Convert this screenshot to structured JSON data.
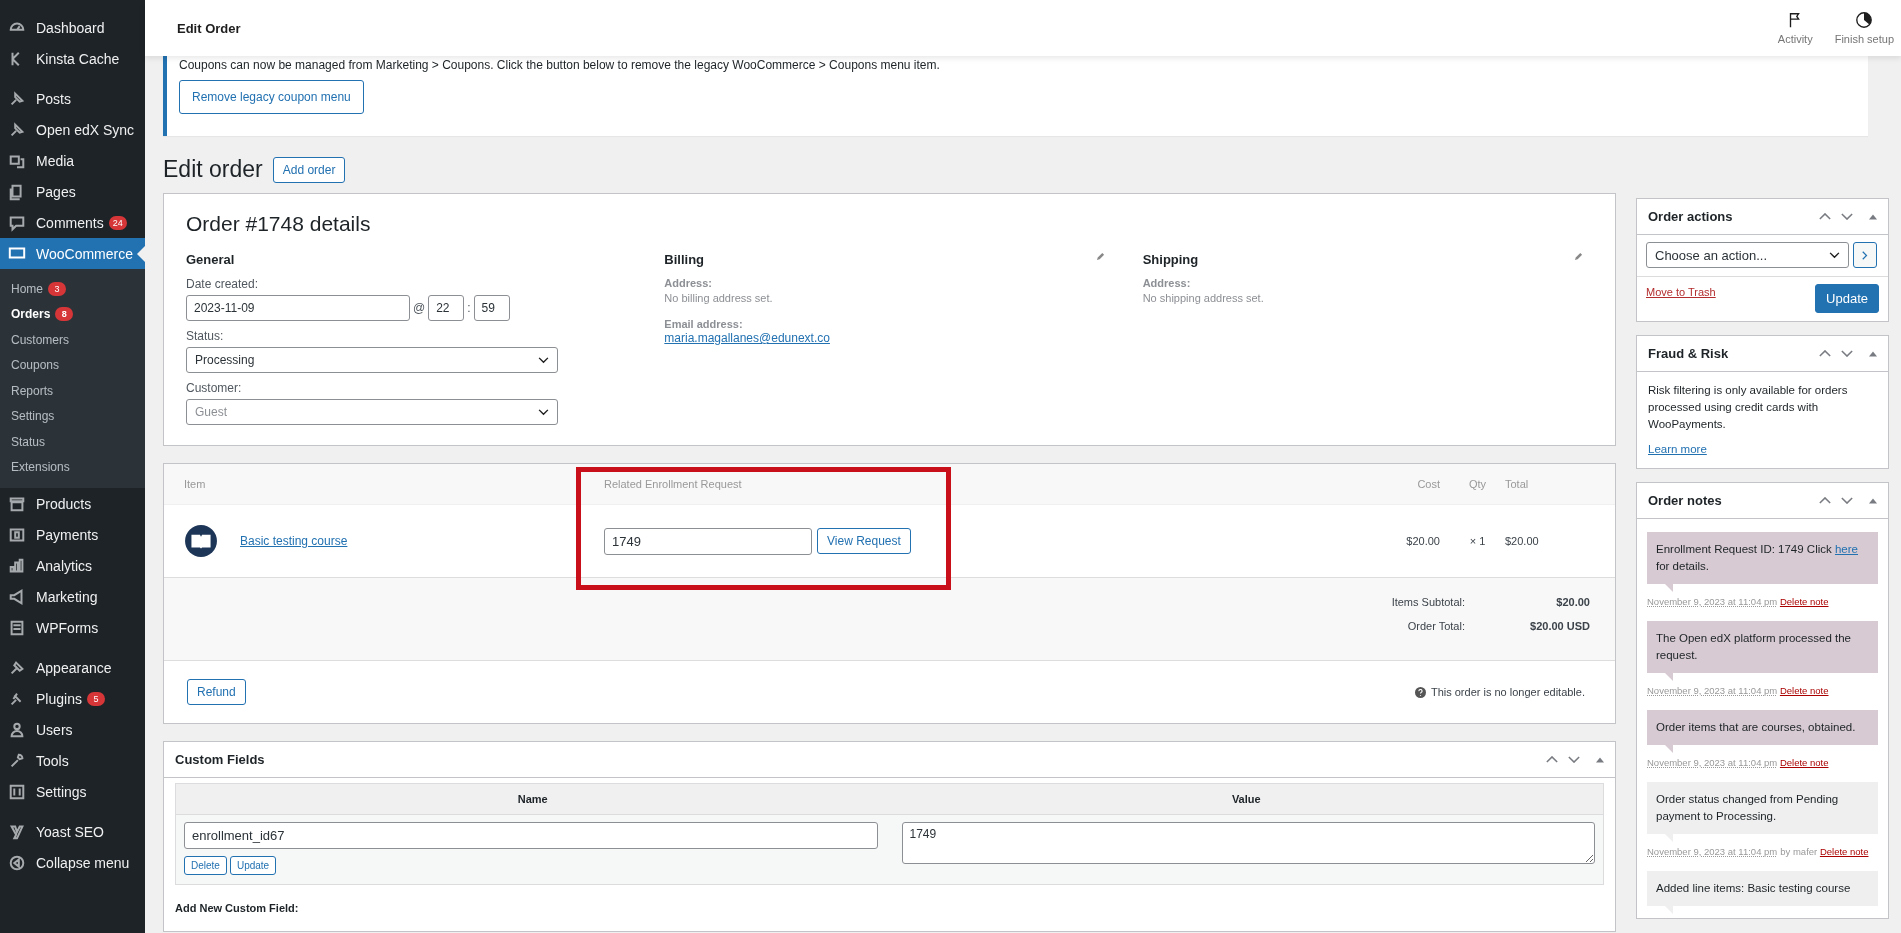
{
  "sidebar": {
    "groups": [
      {
        "items": [
          {
            "label": "Dashboard",
            "selected": false
          },
          {
            "label": "Kinsta Cache",
            "selected": false
          }
        ]
      },
      {
        "items": [
          {
            "label": "Posts",
            "selected": false
          },
          {
            "label": "Open edX Sync",
            "selected": false
          },
          {
            "label": "Media",
            "selected": false
          },
          {
            "label": "Pages",
            "selected": false
          },
          {
            "label": "Comments",
            "badge": "24",
            "selected": false
          },
          {
            "label": "WooCommerce",
            "selected": true,
            "expanded": true,
            "children": [
              {
                "label": "Home",
                "badge": "3",
                "selected": false
              },
              {
                "label": "Orders",
                "badge": "8",
                "selected": true
              },
              {
                "label": "Customers",
                "selected": false
              },
              {
                "label": "Coupons",
                "selected": false
              },
              {
                "label": "Reports",
                "selected": false
              },
              {
                "label": "Settings",
                "selected": false
              },
              {
                "label": "Status",
                "selected": false
              },
              {
                "label": "Extensions",
                "selected": false
              }
            ]
          },
          {
            "label": "Products",
            "selected": false
          },
          {
            "label": "Payments",
            "selected": false
          },
          {
            "label": "Analytics",
            "selected": false
          },
          {
            "label": "Marketing",
            "selected": false
          },
          {
            "label": "WPForms",
            "selected": false
          }
        ]
      },
      {
        "items": [
          {
            "label": "Appearance",
            "selected": false
          },
          {
            "label": "Plugins",
            "badge": "5",
            "selected": false
          },
          {
            "label": "Users",
            "selected": false
          },
          {
            "label": "Tools",
            "selected": false
          },
          {
            "label": "Settings",
            "selected": false
          }
        ]
      },
      {
        "items": [
          {
            "label": "Yoast SEO",
            "selected": false
          },
          {
            "label": "Collapse menu",
            "selected": false
          }
        ]
      }
    ]
  },
  "header": {
    "title": "Edit Order",
    "actions": [
      "Activity",
      "Finish setup"
    ]
  },
  "notice": {
    "text": "Coupons can now be managed from Marketing > Coupons. Click the button below to remove the legacy WooCommerce > Coupons menu item.",
    "button": "Remove legacy coupon menu"
  },
  "page": {
    "title": "Edit order",
    "button": "Add order"
  },
  "order": {
    "title": "Order #1748 details",
    "general": {
      "heading": "General",
      "date_label": "Date created:",
      "date": "2023-11-09",
      "at": "@",
      "hour": "22",
      "sep": ":",
      "minute": "59",
      "status_label": "Status:",
      "status": "Processing",
      "customer_label": "Customer:",
      "customer_placeholder": "Guest"
    },
    "billing": {
      "heading": "Billing",
      "address_label": "Address:",
      "address": "No billing address set.",
      "email_label": "Email address:",
      "email": "maria.magallanes@edunext.co"
    },
    "shipping": {
      "heading": "Shipping",
      "address_label": "Address:",
      "address": "No shipping address set."
    }
  },
  "items": {
    "request_highlighted": true,
    "columns": [
      {
        "label": "Item"
      },
      {
        "label": "Related Enrollment Request"
      },
      {
        "label": "Cost"
      },
      {
        "label": "Qty"
      },
      {
        "label": "Total"
      }
    ],
    "rows": [
      {
        "name": "Basic testing course",
        "request": "1749",
        "button": "View Request",
        "cost": "$20.00",
        "qty": "× 1",
        "total": "$20.00"
      }
    ],
    "totals": [
      {
        "label": "Items Subtotal:",
        "value": "$20.00"
      },
      {
        "label": "Order Total:",
        "value": "$20.00 USD"
      }
    ],
    "refund": "Refund",
    "notice": "This order is no longer editable."
  },
  "custom_fields": {
    "title": "Custom Fields",
    "columns": [
      "Name",
      "Value"
    ],
    "rows": [
      {
        "name": "enrollment_id67",
        "value": "1749",
        "buttons": [
          "Delete",
          "Update"
        ]
      }
    ],
    "add_title": "Add New Custom Field:"
  },
  "order_actions": {
    "title": "Order actions",
    "select": "Choose an action...",
    "trash": "Move to Trash",
    "update": "Update"
  },
  "fraud": {
    "title": "Fraud & Risk",
    "text": "Risk filtering is only available for orders processed using credit cards with WooPayments.",
    "link": "Learn more"
  },
  "notes": {
    "title": "Order notes",
    "items": [
      {
        "kind": "system",
        "text": "Enrollment Request ID: 1749 Click ",
        "link": "here",
        "after": "for details.",
        "date": "November 9, 2023 at 11:04 pm",
        "delete": "Delete note"
      },
      {
        "kind": "system",
        "text": "The Open edX platform processed the request.",
        "date": "November 9, 2023 at 11:04 pm",
        "delete": "Delete note"
      },
      {
        "kind": "system",
        "text": "Order items that are courses, obtained.",
        "date": "November 9, 2023 at 11:04 pm",
        "delete": "Delete note"
      },
      {
        "kind": "private",
        "text": "Order status changed from Pending payment to Processing.",
        "date": "November 9, 2023 at 11:04 pm",
        "by": "by mafer",
        "delete": "Delete note"
      },
      {
        "kind": "private",
        "text": "Added line items: Basic testing course"
      }
    ]
  }
}
